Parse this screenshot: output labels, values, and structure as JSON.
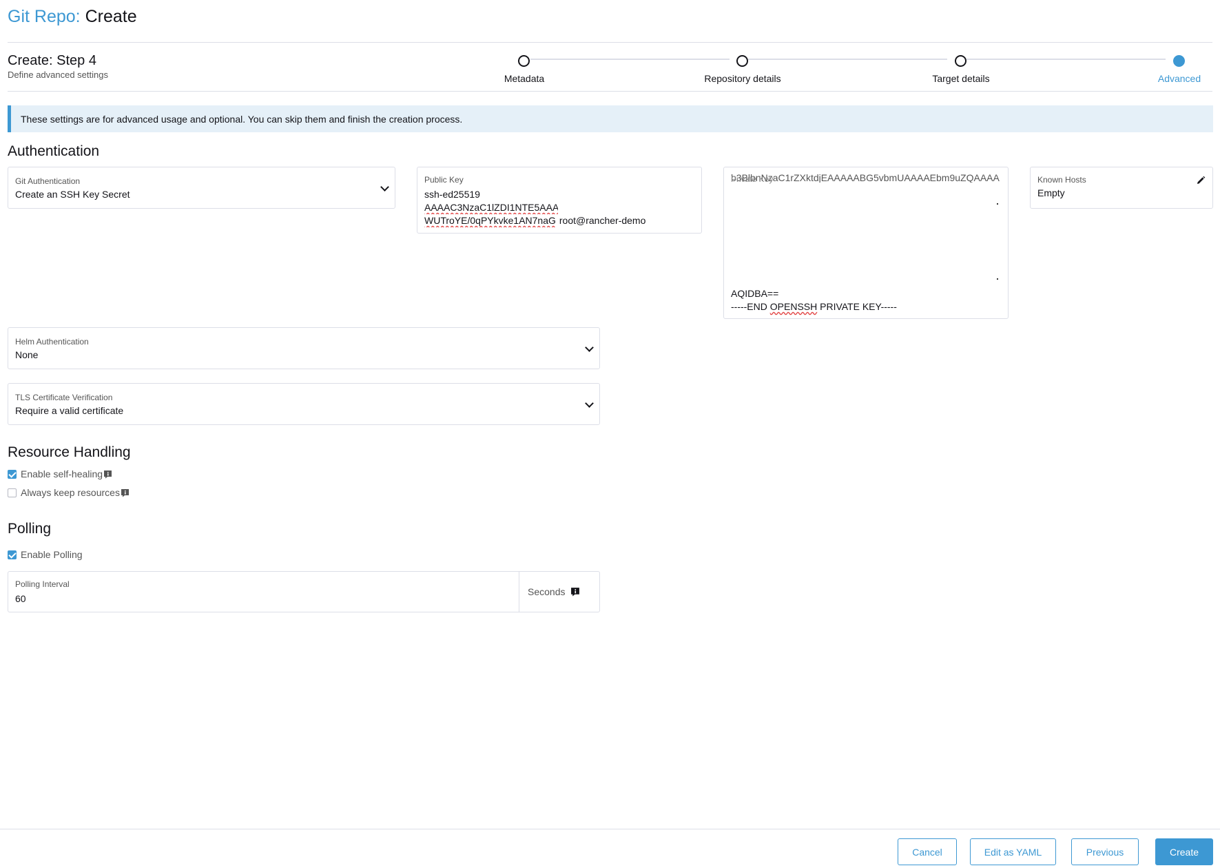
{
  "header": {
    "crumb": "Git Repo:",
    "title": "Create"
  },
  "wizard": {
    "step_title": "Create: Step 4",
    "step_subtitle": "Define advanced settings",
    "steps": [
      {
        "label": "Metadata",
        "active": false
      },
      {
        "label": "Repository details",
        "active": false
      },
      {
        "label": "Target details",
        "active": false
      },
      {
        "label": "Advanced",
        "active": true
      }
    ]
  },
  "banner": {
    "text": "These settings are for advanced usage and optional. You can skip them and finish the creation process."
  },
  "authentication": {
    "title": "Authentication",
    "git_auth": {
      "label": "Git Authentication",
      "value": "Create an SSH Key Secret"
    },
    "public_key": {
      "label": "Public Key",
      "line1": "ssh-ed25519",
      "line2": "AAAAC3NzaC1lZDI1NTE5AAA",
      "line3a": "WUTroYE/0qPYkvke1AN7naG",
      "line3b": " root@rancher-demo"
    },
    "private_key": {
      "label": "Private Key",
      "scrolled_line": "b3BlbnNzaC1rZXktdjEAAAAABG5vbmUAAAAEbm9uZQAAAA",
      "line_end1": "AQIDBA==",
      "line_end2a": "-----END ",
      "line_end2b": "OPENSSH",
      "line_end2c": " PRIVATE KEY-----"
    },
    "known_hosts": {
      "label": "Known Hosts",
      "value": "Empty"
    },
    "helm_auth": {
      "label": "Helm Authentication",
      "value": "None"
    },
    "tls": {
      "label": "TLS Certificate Verification",
      "value": "Require a valid certificate"
    }
  },
  "resource_handling": {
    "title": "Resource Handling",
    "self_healing": {
      "label": "Enable self-healing",
      "checked": true
    },
    "keep_resources": {
      "label": "Always keep resources",
      "checked": false
    }
  },
  "polling": {
    "title": "Polling",
    "enable": {
      "label": "Enable Polling",
      "checked": true
    },
    "interval": {
      "label": "Polling Interval",
      "value": "60",
      "unit": "Seconds"
    }
  },
  "footer": {
    "cancel": "Cancel",
    "edit_yaml": "Edit as YAML",
    "previous": "Previous",
    "create": "Create"
  },
  "colors": {
    "accent": "#3d98d3",
    "banner_bg": "#e5f0f8",
    "border": "#dcdee7"
  },
  "icons": {
    "dropdown": "chevron-down-icon",
    "edit": "pencil-icon",
    "info": "info-icon",
    "check": "checkbox-icon"
  }
}
